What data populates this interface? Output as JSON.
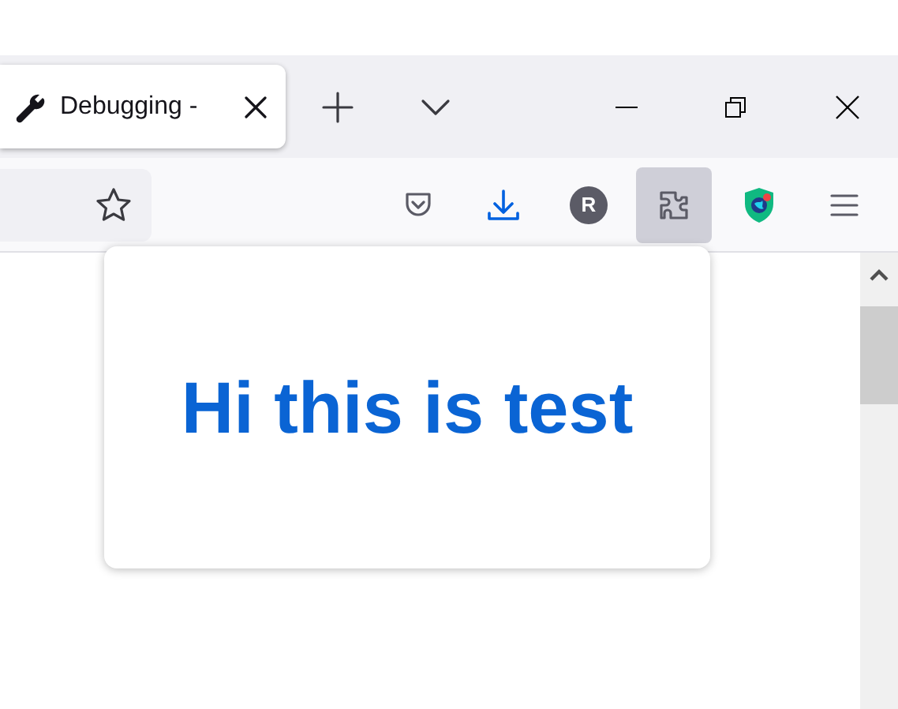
{
  "tabs": [
    {
      "title": "Debugging -",
      "selected": true
    }
  ],
  "toolbar": {
    "buttons": [
      {
        "kind": "pocket",
        "active": false
      },
      {
        "kind": "download",
        "active": false
      },
      {
        "kind": "account",
        "label": "R",
        "active": false
      },
      {
        "kind": "extensions",
        "active": true
      },
      {
        "kind": "shield",
        "active": false
      },
      {
        "kind": "menu",
        "active": false
      }
    ]
  },
  "popup": {
    "heading": "Hi this is test"
  }
}
